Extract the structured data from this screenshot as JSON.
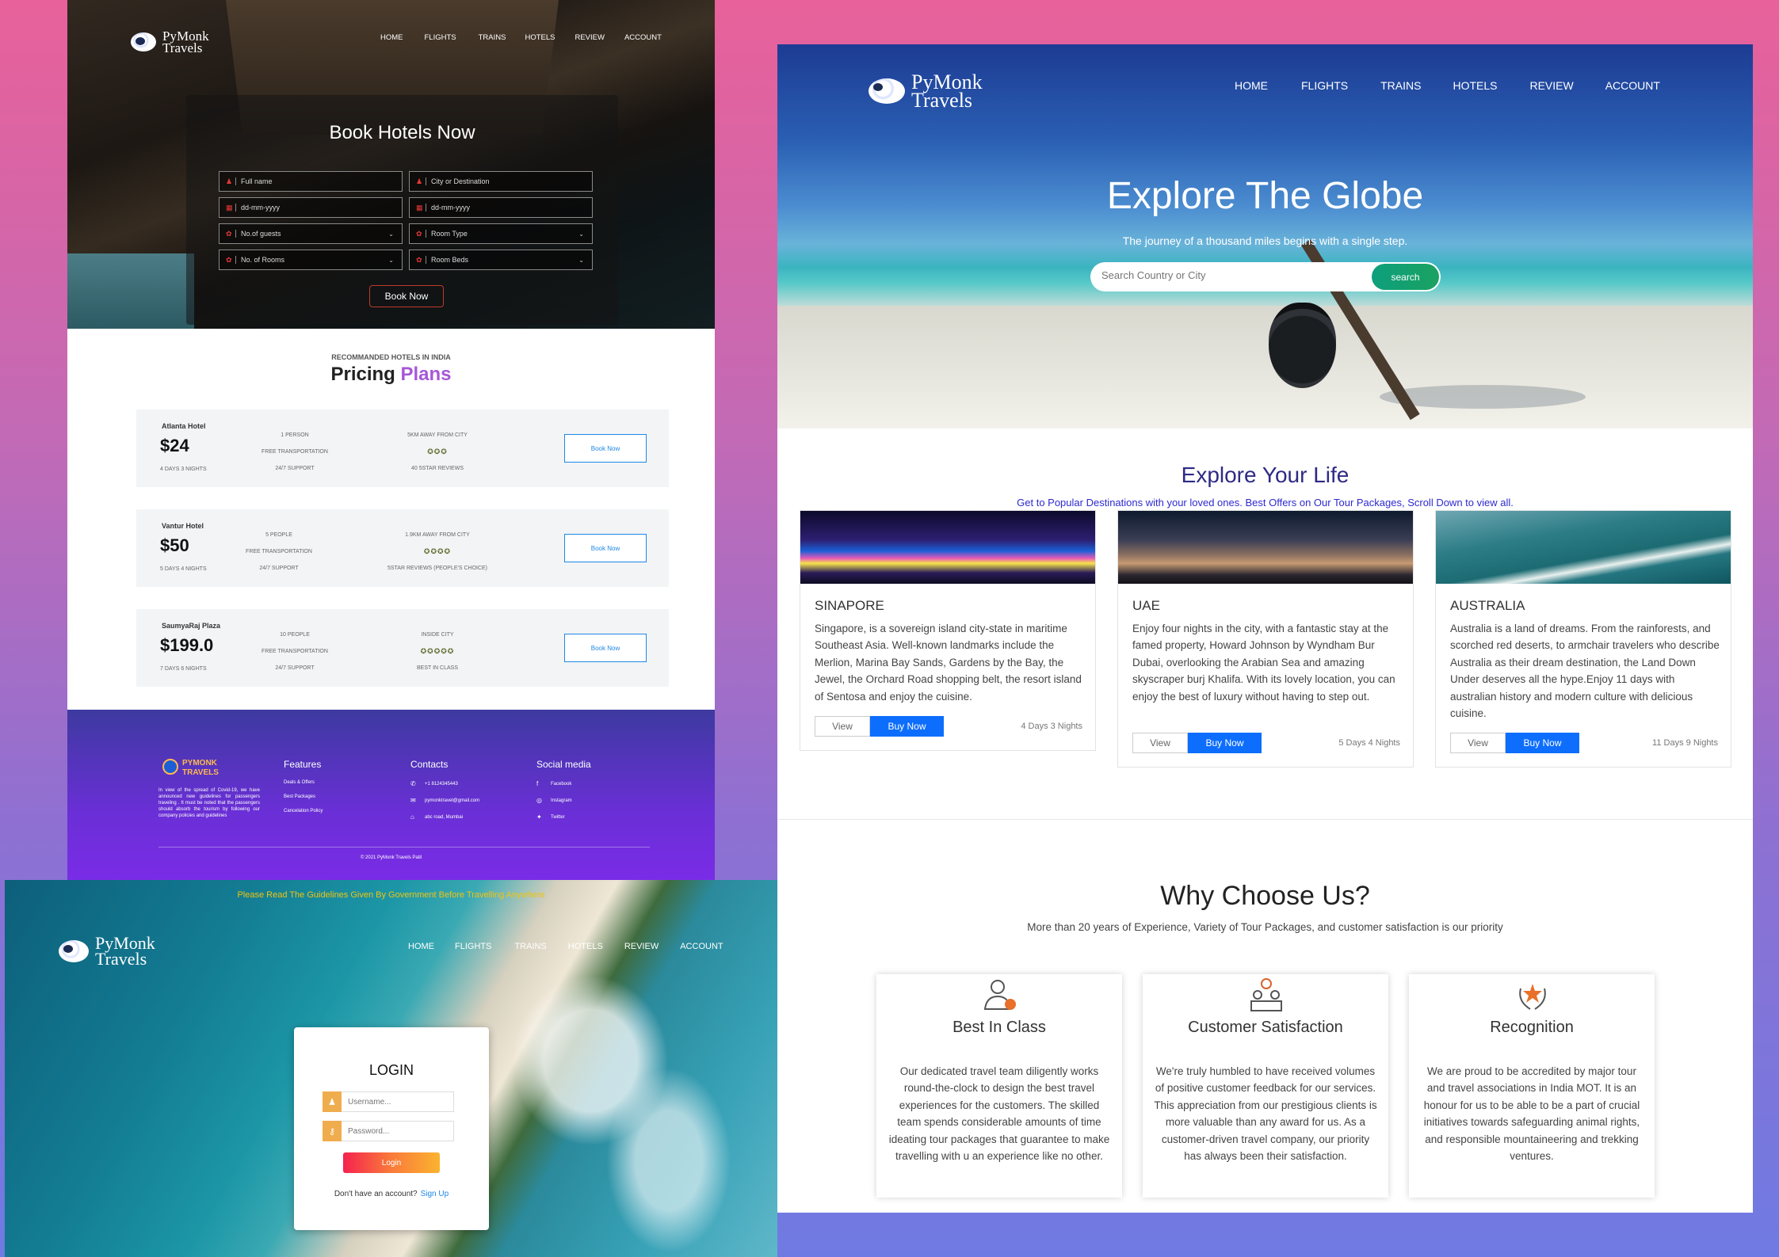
{
  "brand": {
    "line1": "PyMonk",
    "line2": "Travels"
  },
  "nav": [
    "HOME",
    "FLIGHTS",
    "TRAINS",
    "HOTELS",
    "REVIEW",
    "ACCOUNT"
  ],
  "hotel_page": {
    "book_title": "Book Hotels Now",
    "fields": {
      "full_name": "Full name",
      "city": "City or Destination",
      "date1": "dd-mm-yyyy",
      "date2": "dd-mm-yyyy",
      "guests": "No.of guests",
      "room_type": "Room Type",
      "rooms": "No. of Rooms",
      "room_beds": "Room Beds"
    },
    "book_button": "Book Now",
    "plans_kicker": "RECOMMANDED HOTELS IN INDIA",
    "plans_title_a": "Pricing",
    "plans_title_b": "Plans",
    "hotels": [
      {
        "name": "Atlanta Hotel",
        "price": "$24",
        "duration": "4 DAYS 3 NIGHTS",
        "f1": "1 PERSON",
        "f2": "FREE TRANSPORTATION",
        "f3": "24/7 SUPPORT",
        "g1": "5KM AWAY FROM CITY",
        "stars": "✪✪✪",
        "g3": "40 5STAR REVIEWS",
        "button": "Book Now"
      },
      {
        "name": "Vantur Hotel",
        "price": "$50",
        "duration": "5 DAYS 4 NIGHTS",
        "f1": "5 PEOPLE",
        "f2": "FREE TRANSPORTATION",
        "f3": "24/7 SUPPORT",
        "g1": "1.9KM AWAY FROM CITY",
        "stars": "✪✪✪✪",
        "g3": "5STAR REVIEWS (PEOPLE'S CHOICE)",
        "button": "Book Now"
      },
      {
        "name": "SaumyaRaj Plaza",
        "price": "$199.0",
        "duration": "7 DAYS 6 NIGHTS",
        "f1": "10 PEOPLE",
        "f2": "FREE TRANSPORTATION",
        "f3": "24/7 SUPPORT",
        "g1": "INSIDE CITY",
        "stars": "✪✪✪✪✪",
        "g3": "BEST IN CLASS",
        "button": "Book Now"
      }
    ],
    "footer": {
      "logo_line1": "PYMONK",
      "logo_line2": "TRAVELS",
      "about": "In view of the spread of Covid-19, we have announced new guidelines for passengers traveling . It must be noted that the passengers should absorb the tourism by following our company policies and guidelines",
      "features_title": "Features",
      "features": [
        "Deals & Offers",
        "Best Packages",
        "Cancelation Policy"
      ],
      "contacts_title": "Contacts",
      "contacts": [
        "+1 8124345443",
        "pymonktravel@gmail.com",
        "abc road, Mumbai"
      ],
      "social_title": "Social media",
      "social": [
        "Facebook",
        "Instagram",
        "Twitter"
      ],
      "copyright": "© 2021 PyMonk Travels Patil"
    }
  },
  "home_page": {
    "hero_title": "Explore The Globe",
    "hero_sub": "The journey of a thousand miles begins with a single step.",
    "search_placeholder": "Search Country or City",
    "search_button": "search",
    "explore_title": "Explore Your Life",
    "explore_sub": "Get to Popular Destinations with your loved ones. Best Offers on Our Tour Packages, Scroll Down to view all.",
    "destinations": [
      {
        "name": "SINAPORE",
        "desc": "Singapore, is a sovereign island city-state in maritime Southeast Asia. Well-known landmarks include the Merlion, Marina Bay Sands, Gardens by the Bay, the Jewel, the Orchard Road shopping belt, the resort island of Sentosa and enjoy the cuisine.",
        "view": "View",
        "buy": "Buy Now",
        "nights": "4 Days 3 Nights"
      },
      {
        "name": "UAE",
        "desc": "Enjoy four nights in the city, with a fantastic stay at the famed property, Howard Johnson by Wyndham Bur Dubai, overlooking the Arabian Sea and amazing skyscraper burj Khalifa. With its lovely location, you can enjoy the best of luxury without having to step out.",
        "view": "View",
        "buy": "Buy Now",
        "nights": "5 Days 4 Nights"
      },
      {
        "name": "AUSTRALIA",
        "desc": "Australia is a land of dreams. From the rainforests, and scorched red deserts, to armchair travelers who describe Australia as their dream destination, the Land Down Under deserves all the hype.Enjoy 11 days with australian history and modern culture with delicious cuisine.",
        "view": "View",
        "buy": "Buy Now",
        "nights": "11 Days 9 Nights"
      }
    ],
    "why_title": "Why Choose Us?",
    "why_sub": "More than 20 years of Experience, Variety of Tour Packages, and customer satisfaction is our priority",
    "why_cards": [
      {
        "title": "Best In Class",
        "text": "Our dedicated travel team diligently works round-the-clock to design the best travel experiences for the customers. The skilled team spends considerable amounts of time ideating tour packages that guarantee to make travelling with u an experience like no other."
      },
      {
        "title": "Customer Satisfaction",
        "text": "We're truly humbled to have received volumes of positive customer feedback for our services. This appreciation from our prestigious clients is more valuable than any award for us. As a customer-driven travel company, our priority has always been their satisfaction."
      },
      {
        "title": "Recognition",
        "text": "We are proud to be accredited by major tour and travel associations in India MOT. It is an honour for us to be able to be a part of crucial initiatives towards safeguarding animal rights, and responsible mountaineering and trekking ventures."
      }
    ]
  },
  "login_page": {
    "notice": "Please Read The Guidelines Given By Government Before Travelling Anywhere",
    "title": "LOGIN",
    "username_placeholder": "Username...",
    "password_placeholder": "Password...",
    "login_button": "Login",
    "no_account": "Don't have an account?",
    "signup": "Sign Up"
  },
  "colors": {
    "accent_purple": "#a658d9",
    "primary_blue": "#0d6efd",
    "search_green": "#0e9f7d",
    "login_gradient_start": "#f5224f",
    "login_gradient_end": "#fbb330"
  }
}
